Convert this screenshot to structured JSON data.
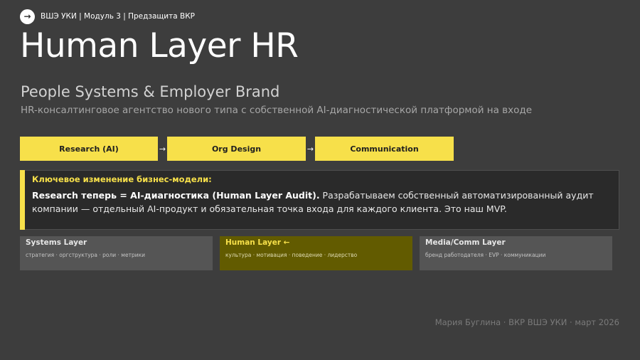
{
  "header": {
    "logo_icon": "arrow-right-icon",
    "logo_glyph": "→",
    "breadcrumb": "ВШЭ УКИ | Модуль 3 | Предзащита ВКР"
  },
  "title": "Human Layer HR",
  "subtitle": "People Systems & Employer Brand",
  "description": "HR-консалтинговое агентство нового типа с собственной AI-диагностической платформой на входе",
  "steps": [
    {
      "label": "Research (AI)"
    },
    {
      "label": "Org Design"
    },
    {
      "label": "Communication"
    }
  ],
  "step_arrow": "→",
  "callout": {
    "label": "Ключевое изменение бизнес-модели:",
    "body_strong": "Research теперь = AI-диагностика (Human Layer Audit).",
    "body_text": " Разрабатываем собственный автоматизированный аудит компании — отдельный AI-продукт и обязательная точка входа для каждого клиента. Это наш MVP."
  },
  "layers": [
    {
      "name": "Systems Layer",
      "tags": "стратегия · оргструктура · роли · метрики",
      "active": false
    },
    {
      "name": "Human Layer ←",
      "tags": "культура · мотивация · поведение · лидерство",
      "active": true
    },
    {
      "name": "Media/Comm Layer",
      "tags": "бренд работодателя · EVP · коммуникации",
      "active": false
    }
  ],
  "footer": "Мария Буглина · ВКР ВШЭ УКИ · март 2026",
  "colors": {
    "background": "#3d3d3d",
    "accent": "#f7e04a",
    "active_layer": "#625b00",
    "layer_bg": "#555555",
    "callout_bg": "#2a2a2a"
  }
}
